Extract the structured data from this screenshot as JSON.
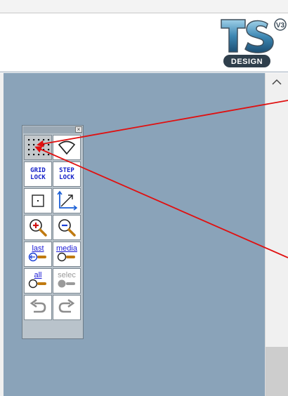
{
  "logo": {
    "letters": "TS",
    "superscript": "V3",
    "badge": "DESIGN"
  },
  "toolbox": {
    "close": "×",
    "grid_lock": [
      "GRID",
      "LOCK"
    ],
    "step_lock": [
      "STEP",
      "LOCK"
    ],
    "last": "last",
    "media": "media",
    "all": "all",
    "select": "selec"
  },
  "colors": {
    "canvas": "#8aa3b9",
    "accent_blue": "#1420c8",
    "annotation_red": "#e01010"
  },
  "icons": [
    "grid-dots-icon",
    "fan-icon",
    "square-icon",
    "axes-icon",
    "zoom-in-icon",
    "zoom-out-icon",
    "back-arrow-icon",
    "forward-arrow-icon",
    "undo-icon",
    "redo-icon",
    "scroll-up-icon"
  ]
}
